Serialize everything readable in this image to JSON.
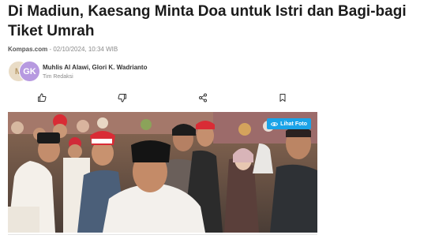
{
  "article": {
    "title": "Di Madiun, Kaesang Minta Doa untuk Istri dan Bagi-bagi Tiket Umrah",
    "source": "Kompas.com",
    "datetime": "- 02/10/2024, 10:34 WIB",
    "authors": "Muhlis Al Alawi, Glori K. Wadrianto",
    "role": "Tim Redaksi",
    "avatar_initials": [
      "M",
      "GK"
    ]
  },
  "actions": [
    "thumbs-up-icon",
    "thumbs-down-icon",
    "share-icon",
    "bookmark-icon"
  ],
  "photo": {
    "button_label": "Lihat Foto"
  },
  "colors": {
    "accent": "#1aa3e8",
    "text": "#1b1b1b",
    "muted": "#8a8a8a"
  }
}
